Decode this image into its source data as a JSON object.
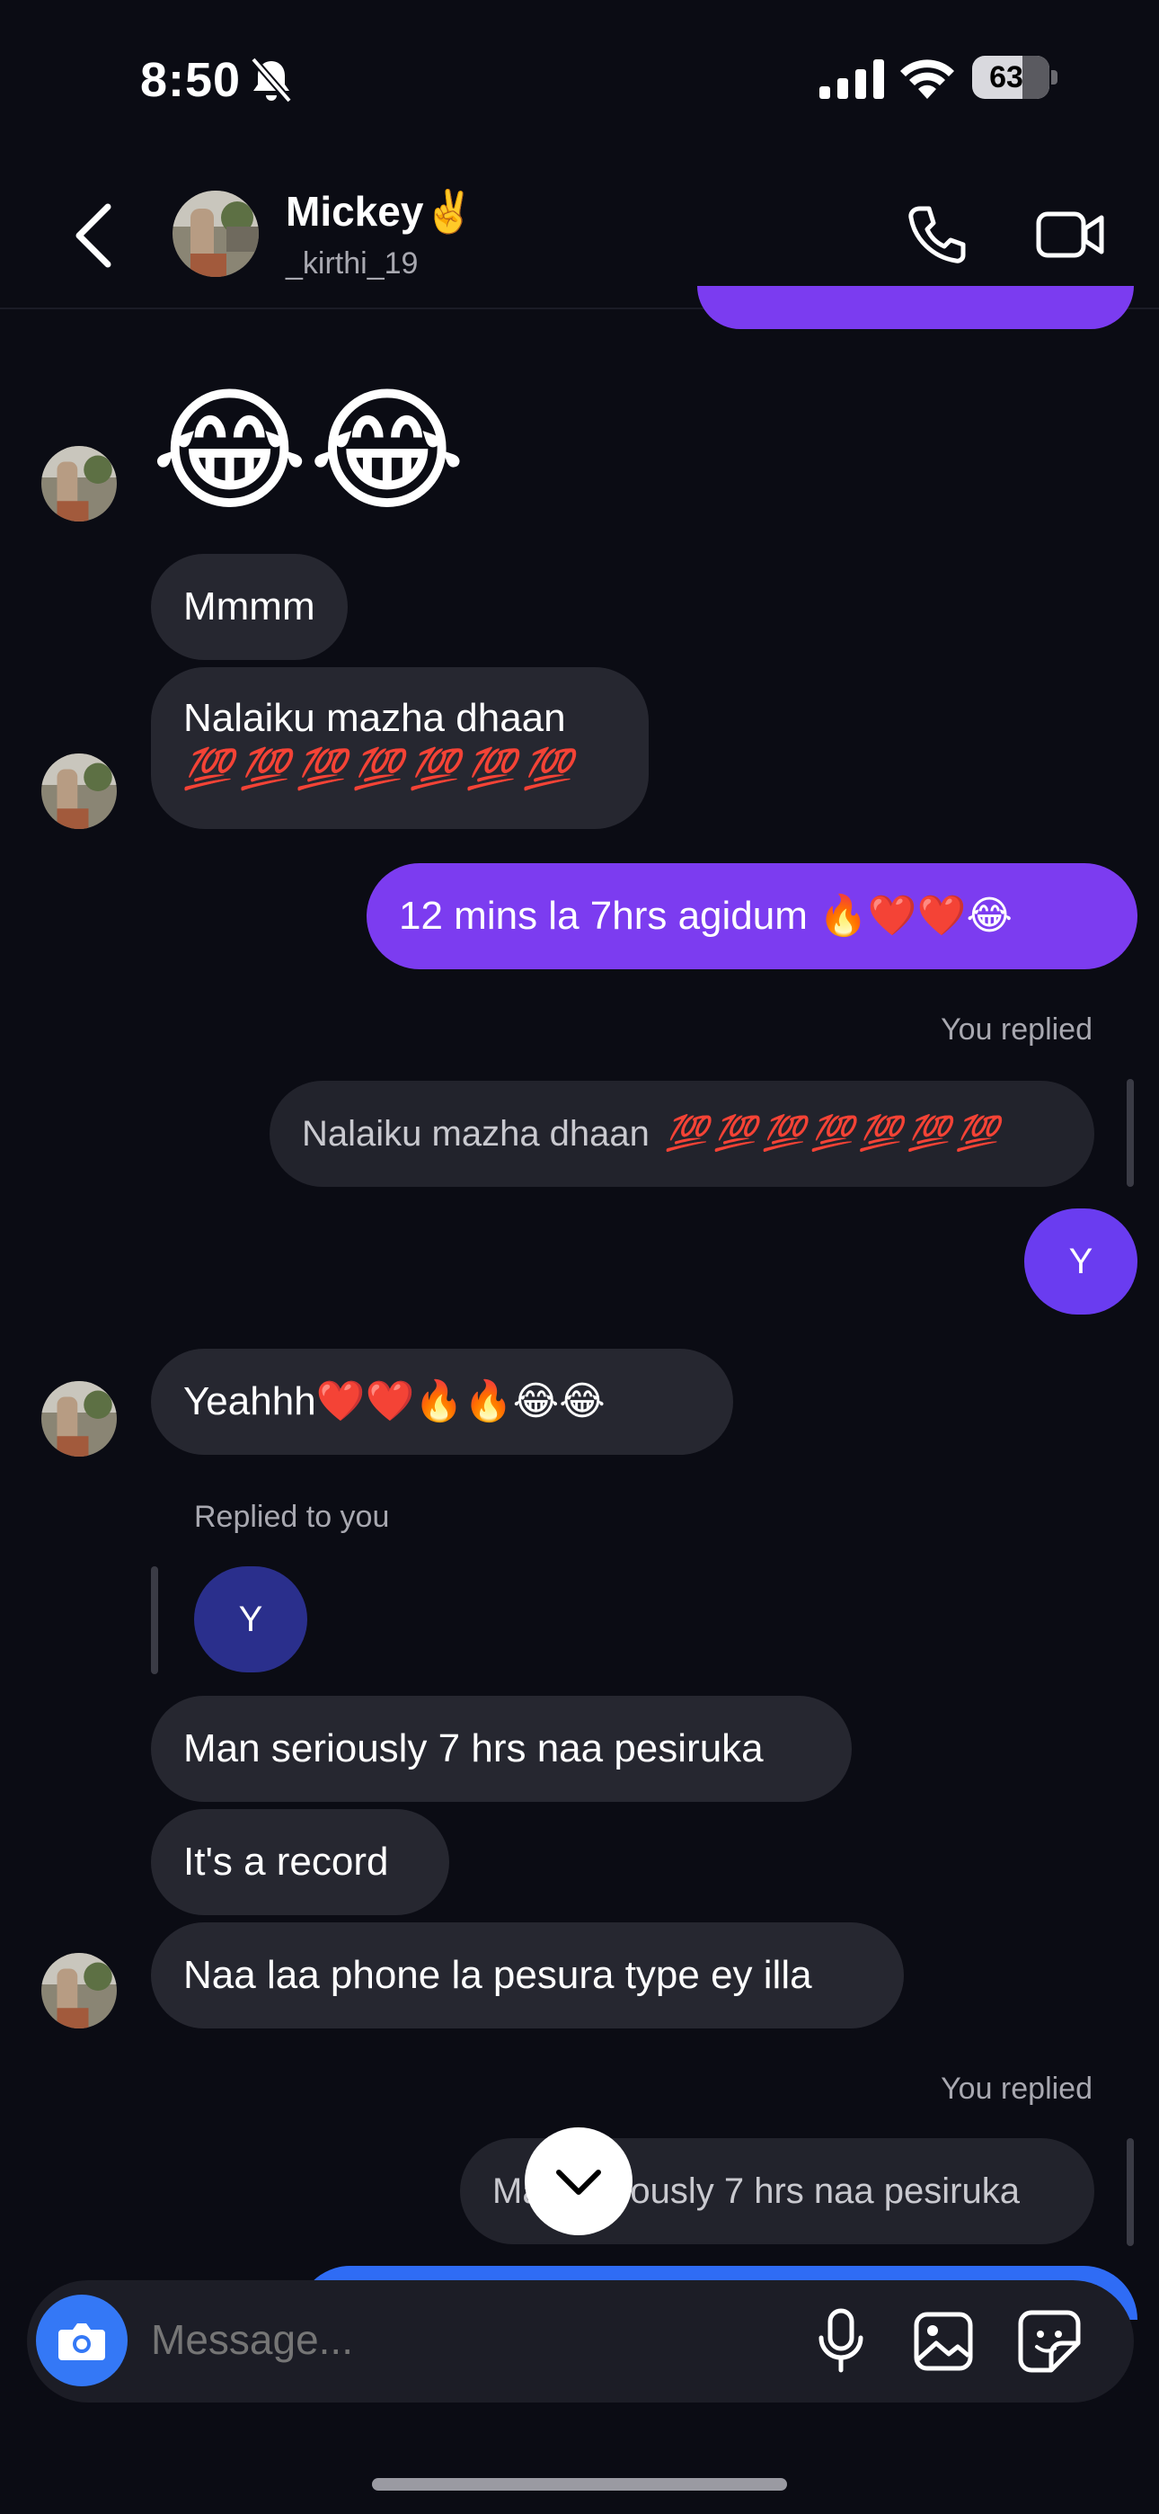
{
  "status_bar": {
    "time": "8:50",
    "battery": "63"
  },
  "header": {
    "name": "Mickey✌️",
    "username": "_kirthi_19"
  },
  "messages": {
    "emoji_laugh": "😂😂",
    "m1": "Mmmm",
    "m2_text": "Nalaiku mazha dhaan",
    "m2_hundreds": "💯 💯 💯 💯 💯 💯 💯",
    "m3_out": "12 mins la 7hrs agidum 🔥❤️❤️😂",
    "you_replied_1": "You replied",
    "quoted_1_text": "Nalaiku mazha dhaan",
    "quoted_1_hundreds": "💯 💯 💯 💯 💯 💯 💯",
    "y_letter": "Y",
    "m4": "Yeahhh❤️❤️🔥🔥😂😂",
    "replied_to_you": "Replied to you",
    "m5": "Man seriously 7 hrs naa pesiruka",
    "m6": "It's a record",
    "m7": "Naa laa phone la pesura type ey illa",
    "you_replied_2": "You replied",
    "quoted_2": "Man seriously 7 hrs naa pesiruka"
  },
  "composer": {
    "placeholder": "Message..."
  },
  "icons": {
    "bell": "bell-slash-icon",
    "signal": "signal-icon",
    "wifi": "wifi-icon",
    "battery": "battery-icon",
    "back": "chevron-left-icon",
    "call": "phone-icon",
    "video": "video-camera-icon",
    "camera": "camera-icon",
    "mic": "microphone-icon",
    "gallery": "image-icon",
    "sticker": "sticker-icon",
    "scroll_down": "chevron-down-icon"
  },
  "colors": {
    "background": "#0b0c14",
    "incoming_bubble": "#262730",
    "outgoing_bubble": "#7c3cf0",
    "camera_button": "#3478f6",
    "reply_avatar_own": "#6a3cf0",
    "reply_avatar_quoted": "#2a2f8c"
  }
}
